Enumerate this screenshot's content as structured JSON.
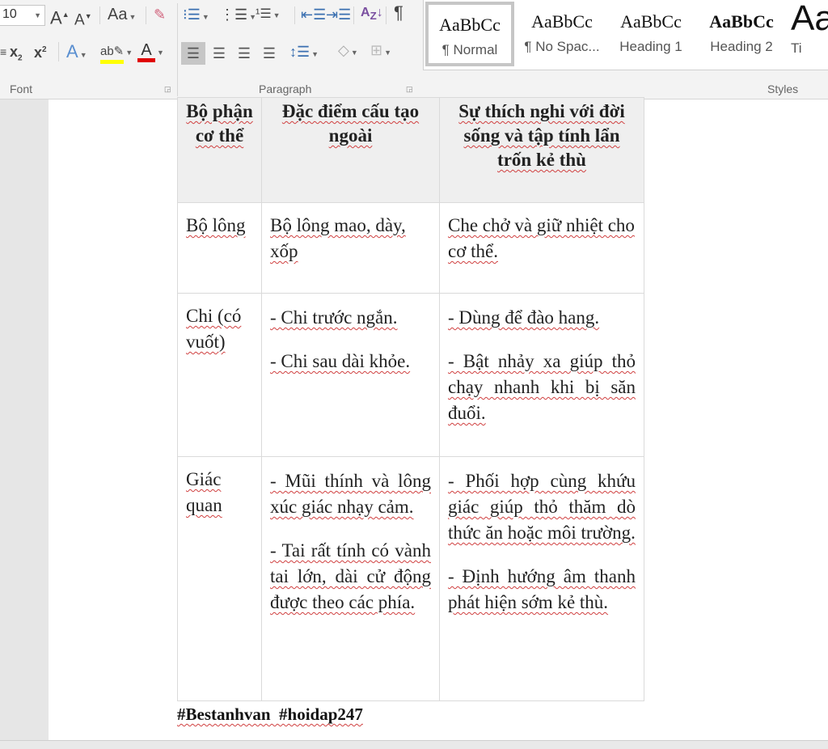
{
  "ribbon": {
    "font_size": "10",
    "font_group_label": "Font",
    "paragraph_group_label": "Paragraph",
    "styles_group_label": "Styles",
    "change_case_label": "Aa",
    "colors": {
      "highlight": "#ffff00",
      "font_color": "#e00000"
    },
    "styles": [
      {
        "preview": "AaBbCc",
        "name": "¶ Normal",
        "selected": true
      },
      {
        "preview": "AaBbCc",
        "name": "¶ No Spac..."
      },
      {
        "preview": "AaBbCc",
        "name": "Heading 1"
      },
      {
        "preview": "AaBbCc",
        "name": "Heading 2"
      },
      {
        "preview": "Aa",
        "name": "Ti"
      }
    ]
  },
  "table": {
    "headers": [
      "Bộ phận cơ thể",
      "Đặc điểm cấu tạo ngoài",
      "Sự thích nghi với đời sống và tập tính lẩn trốn kẻ thù"
    ],
    "rows": [
      {
        "part": "Bộ lông",
        "features": [
          "Bộ lông mao, dày, xốp"
        ],
        "adaptation": [
          "Che chở và giữ nhiệt cho cơ thể."
        ]
      },
      {
        "part": "Chi (có vuốt)",
        "features": [
          "- Chi trước ngắn.",
          "- Chi sau dài khỏe."
        ],
        "adaptation": [
          "- Dùng để đào hang.",
          "- Bật nhảy xa giúp thỏ chạy nhanh khi bị săn đuổi."
        ]
      },
      {
        "part": "Giác quan",
        "features": [
          "- Mũi thính và lông xúc giác nhạy cảm.",
          "- Tai rất tính có vành tai lớn, dài cử động được theo các phía."
        ],
        "adaptation": [
          "- Phối hợp cùng khứu giác giúp thỏ thăm dò thức ăn hoặc môi trường.",
          "- Định hướng âm thanh phát hiện sớm kẻ thù."
        ]
      }
    ]
  },
  "footer_text": "#Bestanhvan  #hoidap247"
}
